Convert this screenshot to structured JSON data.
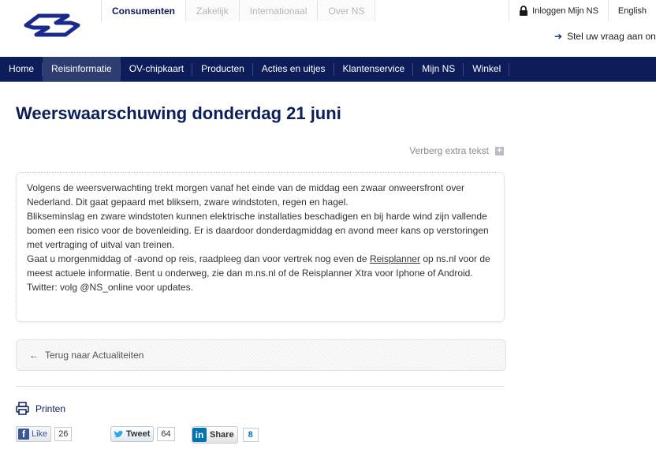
{
  "top_tabs": [
    "Consumenten",
    "Zakelijk",
    "Internationaal",
    "Over NS"
  ],
  "utility": {
    "login": "Inloggen Mijn NS",
    "language": "English"
  },
  "ask": "Stel uw vraag aan ons",
  "mainnav": [
    "Home",
    "Reisinformatie",
    "OV-chipkaart",
    "Producten",
    "Acties en uitjes",
    "Klantenservice",
    "Mijn NS",
    "Winkel"
  ],
  "article": {
    "title": "Weerswaarschuwing donderdag 21 juni",
    "toggle_label": "Verberg extra tekst",
    "para1": "Volgens de weersverwachting trekt morgen vanaf het einde van de middag een zwaar onweersfront over Nederland. Dit gaat gepaard met bliksem, zware windstoten, regen en hagel.",
    "para2": "Blikseminslag en zware windstoten kunnen elektrische installaties beschadigen en bij harde wind zijn vallende bomen een risico voor de bovenleiding. Er is daardoor donderdagmiddag en avond meer kans op verstoringen met vertraging of uitval van treinen.",
    "para3_before": "Gaat u morgenmiddag of -avond op reis, raadpleeg dan voor vertrek nog even de ",
    "para3_link": "Reisplanner",
    "para3_after": " op ns.nl voor de meest actuele informatie. Bent u onderweg, zie dan m.ns.nl of de Reisplanner Xtra voor Iphone of Android. Twitter: volg @NS_online voor updates."
  },
  "back_link": "Terug naar Actualiteiten",
  "print_label": "Printen",
  "social": {
    "facebook": {
      "label": "Like",
      "count": "26"
    },
    "twitter": {
      "label": "Tweet",
      "count": "64"
    },
    "linkedin": {
      "label": "Share",
      "count": "8"
    }
  },
  "colors": {
    "brand_navy": "#0c1d5a",
    "nav_active": "#2e3d70",
    "logo_blue": "#1a2a8a"
  }
}
